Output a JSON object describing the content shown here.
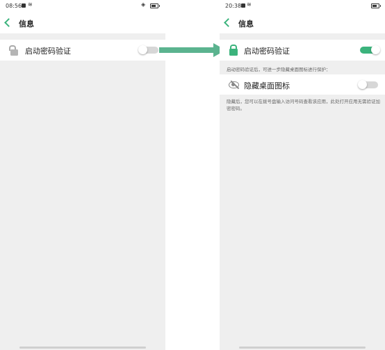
{
  "left": {
    "status": {
      "time": "08:56"
    },
    "header": {
      "title": "信息"
    },
    "rows": [
      {
        "label": "启动密码验证",
        "toggle": "off"
      }
    ]
  },
  "right": {
    "status": {
      "time": "20:38"
    },
    "header": {
      "title": "信息"
    },
    "rows": [
      {
        "label": "启动密码验证",
        "toggle": "on",
        "hint": "启动密码验证后，可进一步隐藏桌面图标进行保护："
      },
      {
        "label": "隐藏桌面图标",
        "toggle": "off",
        "hint": "隐藏后，您可以在拨号盘输入访问号码查看该应用，此处打开应用无需验证加密密码。"
      }
    ]
  },
  "colors": {
    "accent": "#3bb37c",
    "arrow": "#5bb38f",
    "background": "#efefef"
  },
  "icons": {
    "lock_open": "lock-open-icon",
    "lock_closed": "lock-icon",
    "eye_hidden": "eye-hidden-icon"
  }
}
